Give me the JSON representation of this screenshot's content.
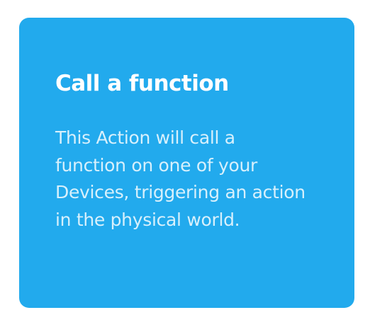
{
  "card": {
    "title": "Call a function",
    "description": "This Action will call a function on one of your Devices, triggering an action in the physical world.",
    "background_color": "#22aaed"
  }
}
